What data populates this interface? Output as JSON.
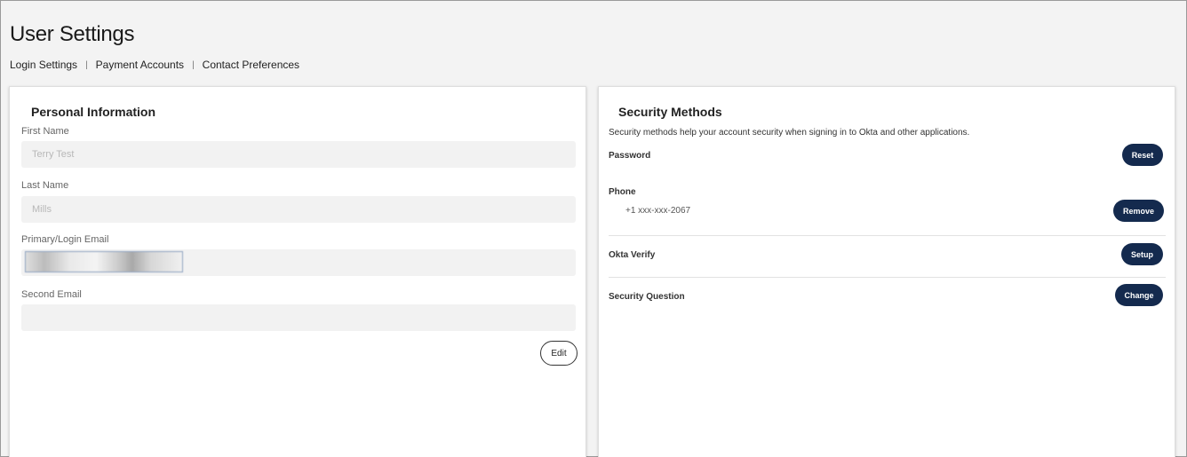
{
  "page": {
    "title": "User Settings"
  },
  "subnav": {
    "items": [
      "Login Settings",
      "Payment Accounts",
      "Contact Preferences"
    ],
    "separator": "|"
  },
  "personal_info": {
    "title": "Personal Information",
    "fields": [
      {
        "label": "First Name",
        "value": "Terry Test"
      },
      {
        "label": "Last Name",
        "value": "Mills"
      },
      {
        "label": "Primary/Login Email",
        "value": ""
      },
      {
        "label": "Second Email",
        "value": ""
      }
    ],
    "edit_label": "Edit"
  },
  "security": {
    "title": "Security Methods",
    "description": "Security methods help your account security when signing in to Okta and other applications.",
    "methods": [
      {
        "label": "Password",
        "sub": "",
        "action": "Reset"
      },
      {
        "label": "Phone",
        "sub": "+1 xxx-xxx-2067",
        "action": "Remove"
      },
      {
        "label": "Okta Verify",
        "sub": "",
        "action": "Setup"
      },
      {
        "label": "Security Question",
        "sub": "",
        "action": "Change"
      }
    ]
  },
  "colors": {
    "primary_button": "#142a4e",
    "background": "#f3f3f3",
    "field_bg": "#f2f2f2"
  }
}
